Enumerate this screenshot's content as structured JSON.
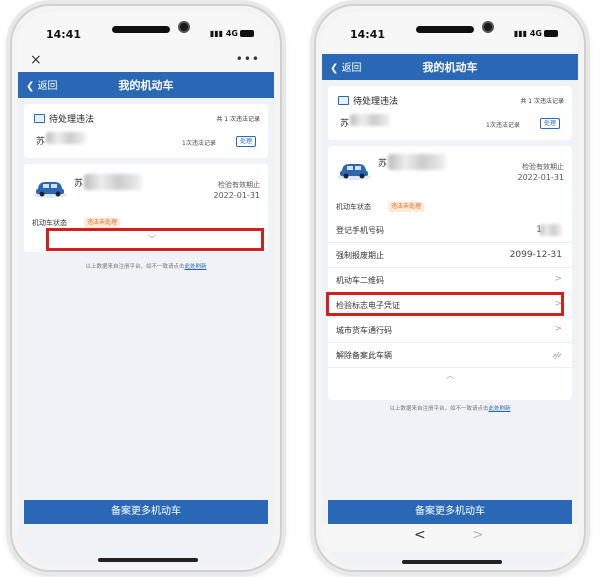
{
  "status": {
    "time": "14:41",
    "network": "4G"
  },
  "wechat_bar": {
    "close": "×",
    "more": "•••"
  },
  "nav": {
    "back_label": "返回",
    "title": "我的机动车"
  },
  "violations": {
    "title": "待处理违法",
    "total": "共 1 次违法记录",
    "plate_prefix": "苏",
    "count": "1次违法记录",
    "handle_button": "处理"
  },
  "vehicle": {
    "plate_prefix": "苏",
    "inspection_label": "检验有效期止",
    "inspection_date": "2022-01-31",
    "status_label": "机动车状态",
    "status_badge": "违法未处理"
  },
  "details": [
    {
      "label": "登记手机号码",
      "value": "1"
    },
    {
      "label": "强制报废期止",
      "value": "2099-12-31"
    },
    {
      "label": "机动车二维码",
      "chevron": ">"
    },
    {
      "label": "检验标志电子凭证",
      "chevron": ">"
    },
    {
      "label": "城市货车通行码",
      "chevron": ">"
    },
    {
      "label": "解除备案此车辆"
    }
  ],
  "footnote": {
    "text": "以上数据来自注册平台，如不一致请点击",
    "link": "此处刷新"
  },
  "bottom_button": "备案更多机动车",
  "toolbar": {
    "back": "<",
    "forward": ">"
  },
  "icons": {
    "back": "chevron-left-icon",
    "expand": "chevron-down-icon",
    "collapse": "chevron-up-icon"
  },
  "colors": {
    "primary": "#2a68b5",
    "highlight": "#d21f1f",
    "badge_text": "#e86a2a",
    "badge_bg": "#fdebd9"
  }
}
